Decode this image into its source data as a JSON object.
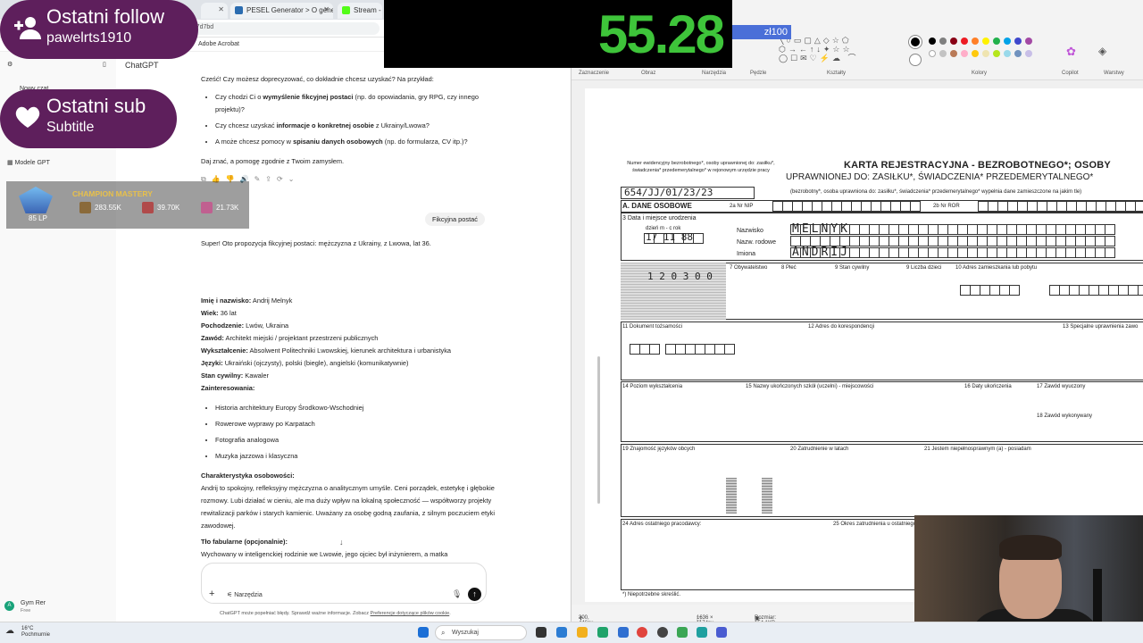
{
  "browser": {
    "tabs": [
      {
        "label": "",
        "color": "#ffffff"
      },
      {
        "label": "PESEL Generator > O generato",
        "color": "#2b6cb0"
      },
      {
        "label": "Stream - K",
        "color": "#53fc18"
      }
    ],
    "address_fragment": "36b7d7bd",
    "bookmark": "Adobe Acrobat"
  },
  "sidebar": {
    "app_title": "ChatGPT",
    "items": [
      "Nowy czat",
      "Modele GPT"
    ],
    "user_name": "Gym Rer",
    "user_plan": "Free"
  },
  "chat": {
    "intro": "Cześć! Czy możesz doprecyzować, co dokładnie chcesz uzyskać? Na przykład:",
    "bullets": [
      {
        "pre": "Czy chodzi Ci o ",
        "bold": "wymyślenie fikcyjnej postaci",
        "post": " (np. do opowiadania, gry RPG, czy innego projektu)?"
      },
      {
        "pre": "Czy chcesz uzyskać ",
        "bold": "informacje o konkretnej osobie",
        "post": " z Ukrainy/Lwowa?"
      },
      {
        "pre": "A może chcesz pomocy w ",
        "bold": "spisaniu danych osobowych",
        "post": " (np. do formularza, CV itp.)?"
      }
    ],
    "closing": "Daj znać, a pomogę zgodnie z Twoim zamysłem.",
    "user_message": "Fikcyjna postać",
    "response_intro": "Super! Oto propozycja fikcyjnej postaci: mężczyzna z Ukrainy, z Lwowa, lat 36.",
    "fields": [
      {
        "label": "Imię i nazwisko:",
        "value": " Andrij Melnyk"
      },
      {
        "label": "Wiek:",
        "value": " 36 lat"
      },
      {
        "label": "Pochodzenie:",
        "value": " Lwów, Ukraina"
      },
      {
        "label": "Zawód:",
        "value": " Architekt miejski / projektant przestrzeni publicznych"
      },
      {
        "label": "Wykształcenie:",
        "value": " Absolwent Politechniki Lwowskiej, kierunek architektura i urbanistyka"
      },
      {
        "label": "Języki:",
        "value": " Ukraiński (ojczysty), polski (biegle), angielski (komunikatywnie)"
      },
      {
        "label": "Stan cywilny:",
        "value": " Kawaler"
      },
      {
        "label": "Zainteresowania:",
        "value": ""
      }
    ],
    "interests": [
      "Historia architektury Europy Środkowo-Wschodniej",
      "Rowerowe wyprawy po Karpatach",
      "Fotografia analogowa",
      "Muzyka jazzowa i klasyczna"
    ],
    "character_heading": "Charakterystyka osobowości:",
    "character_text": "Andrij to spokojny, refleksyjny mężczyzna o analitycznym umyśle. Ceni porządek, estetykę i głębokie rozmowy. Lubi działać w cieniu, ale ma duży wpływ na lokalną społeczność — współtworzy projekty rewitalizacji parków i starych kamienic. Uważany za osobę godną zaufania, z silnym poczuciem etyki zawodowej.",
    "background_heading": "Tło fabularne (opcjonalnie):",
    "background_text": "Wychowany w inteligenckiej rodzinie we Lwowie, jego ojciec był inżynierem, a matka"
  },
  "composer": {
    "tools_label": "Narzędzia",
    "disclaimer_pre": "ChatGPT może popełniać błędy. Sprawdź ważne informacje. Zobacz ",
    "disclaimer_link": "Preferencje dotyczące plików cookie",
    "disclaimer_post": "."
  },
  "paint": {
    "groups": [
      "Zaznaczenie",
      "Obraz",
      "Narzędzia",
      "Pędzle",
      "Kształty",
      "Kolory",
      "Copilot",
      "Warstwy"
    ],
    "colors": [
      "#000000",
      "#7f7f7f",
      "#880015",
      "#ed1c24",
      "#ff7f27",
      "#fff200",
      "#22b14c",
      "#00a2e8",
      "#3f48cc",
      "#a349a4",
      "#ffffff",
      "#c3c3c3",
      "#b97a57",
      "#ffaec9",
      "#ffc90e",
      "#efe4b0",
      "#b5e61d",
      "#99d9ea",
      "#7092be",
      "#c8bfe7"
    ],
    "status": {
      "cursor": "300, 446px",
      "selection": "1636 × 1174px",
      "size": "Rozmiar: 154,1KB"
    },
    "form": {
      "evidence_note": "Numer ewidencyjny bezrobotnego*, osoby uprawnionej do: zasiłku*, świadczenia* przedemerytalnego* w rejonowym urzędzie pracy",
      "evidence_number": "654/JJ/01/23/23",
      "title": "KARTA REJESTRACYJNA - BEZROBOTNEGO*; OSOBY",
      "subtitle": "UPRAWNIONEJ DO: ZASIŁKU*, ŚWIADCZENIA* PRZEDEMERYTALNEGO*",
      "note": "(bezrobotny*, osoba uprawniona do: zasiłku*, świadczenia* przedemerytalnego* wypełnia dane zamieszczone na jakim tle)",
      "section_a": "A. DANE OSOBOWE",
      "labels": {
        "nip": "2a  Nr NIP",
        "ror": "2b  Nr ROR",
        "dob": "3  Data i miejsce urodzenia",
        "dmr": "dzień   m - c   rok",
        "surname": "Nazwisko",
        "maiden": "Nazw. rodowe",
        "names": "Imiona",
        "citizenship": "7  Obywatelstwo",
        "sex": "8  Płeć",
        "marital": "9  Stan cywilny",
        "children": "9  Liczba dzieci",
        "address": "10  Adres zamieszkania lub pobytu",
        "id_doc": "11  Dokument tożsamości",
        "corr": "12  Adres do korespondencji",
        "special": "13  Specjalne uprawnienia zawo",
        "education": "14  Poziom wykształcenia",
        "schools": "15  Nazwy ukończonych szkół (uczelni) - miejscowości",
        "grad": "16  Daty ukończenia",
        "profession": "17  Zawód wyuczony",
        "practiced": "18  Zawód wykonywany",
        "languages": "19  Znajomość języków obcych",
        "employment": "20  Zatrudnienie w latach",
        "disability": "21  Jestem niepełnosprawnym (a) - posiadam",
        "last_employer": "24  Adres ostatniego pracodawcy:",
        "last_period": "25  Okres zatrudnienia u ostatniego",
        "footer": "*) Niepotrzebne skreślić."
      },
      "handwriting": {
        "surname": "MELNYK",
        "names": "ANDRIJ",
        "dob": "17 11 88",
        "reg": "1 2 0 3 0 0"
      }
    }
  },
  "overlays": {
    "follow": {
      "title": "Ostatni follow",
      "subtitle": "pawelrts1910"
    },
    "sub": {
      "title": "Ostatni sub",
      "subtitle": "Subtitle"
    },
    "timer": "55.28",
    "price": "zł100",
    "mastery": {
      "heading": "CHAMPION MASTERY",
      "lp": "85 LP",
      "champions": [
        {
          "points": "283.55K",
          "color": "#8a6a3a"
        },
        {
          "points": "39.70K",
          "color": "#b04a4a"
        },
        {
          "points": "21.73K",
          "color": "#c06090"
        }
      ]
    }
  },
  "taskbar": {
    "weather_temp": "16°C",
    "weather_desc": "Pochmurnie",
    "search": "Wyszukaj"
  }
}
